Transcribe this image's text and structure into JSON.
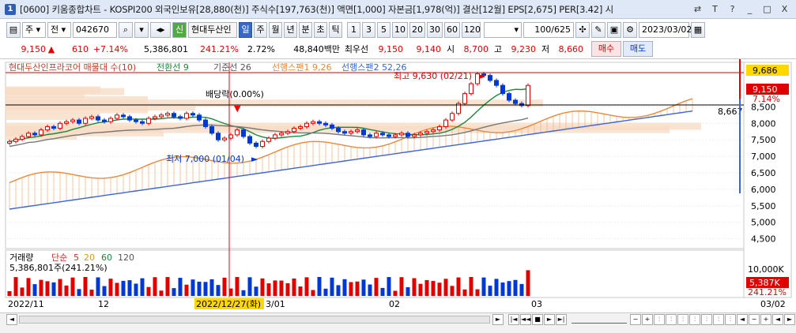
{
  "window": {
    "number": "1",
    "title": "[0600] 키움종합차트 - KOSPI200 외국인보유[28,880(천)] 주식수[197,763(천)] 액면[1,000] 자본금[1,978(억)] 결산[12월] EPS[2,675] PER[3.42] 시",
    "controls": [
      "⇄",
      "T",
      "?",
      "_",
      "□",
      "X"
    ]
  },
  "toolbar": {
    "type_select": "주",
    "type_jeon": "전",
    "code": "042670",
    "company": "현대두산인",
    "company_badge": "신",
    "periods": [
      "일",
      "주",
      "월",
      "년",
      "분",
      "초",
      "틱"
    ],
    "active_period": "일",
    "intervals": [
      "1",
      "3",
      "5",
      "10",
      "20",
      "30",
      "60",
      "120"
    ],
    "count": "100",
    "total": "/625",
    "date": "2023/03/02"
  },
  "quote": {
    "price": "9,150",
    "arrow": "▲",
    "change": "610",
    "change_pct": "+7.14%",
    "volume": "5,386,801",
    "volume_ratio": "241.21%",
    "turnover": "2.72%",
    "amount": "48,840백만",
    "priority_label": "최우선",
    "ask": "9,150",
    "bid": "9,140",
    "open_label": "시",
    "open": "8,700",
    "high_label": "고",
    "high": "9,230",
    "low_label": "저",
    "low": "8,660",
    "buy_label": "매수",
    "sell_label": "매도"
  },
  "chart": {
    "legend": {
      "name": "현대두산인프라코어 매물대 수(10)",
      "conv": "전환선 9",
      "base": "기준선 26",
      "span1": "선행스팬1 9,26",
      "span2": "선행스팬2 52,26"
    },
    "annotations": {
      "dividend": "배당락(0.00%)",
      "min": "최저 7,000 (01/04)",
      "max": "최고 9,630 (02/21)",
      "last_price_label": "8,667"
    },
    "price_axis": [
      "9,686",
      "9,150",
      "7.14%",
      "8,500",
      "8,000",
      "7,500",
      "7,000",
      "6,500",
      "6,000",
      "5,500",
      "5,000",
      "4,500"
    ],
    "volume_legend": {
      "title": "거래량",
      "ma_label": "단순",
      "ma5": "5",
      "ma20": "20",
      "ma60": "60",
      "ma120": "120",
      "current": "5,386,801주(241.21%)"
    },
    "volume_axis": [
      "10,000K",
      "5,000K",
      "5,387K",
      "241.21%"
    ],
    "x_labels": [
      "2022/11",
      "12",
      "2022/12/27(화)",
      "3/01",
      "02",
      "03",
      "03/02"
    ]
  },
  "chart_data": {
    "type": "candlestick",
    "title": "현대두산인프라코어",
    "ylim": [
      4300,
      9800
    ],
    "last_close": 9150,
    "high": 9630,
    "low": 7000,
    "closes": [
      7450,
      7520,
      7600,
      7700,
      7650,
      7800,
      7900,
      7850,
      8000,
      8050,
      8100,
      8000,
      8150,
      8200,
      8100,
      8050,
      8150,
      8250,
      8200,
      8100,
      8050,
      8000,
      8150,
      8200,
      8250,
      8300,
      8200,
      8150,
      8300,
      8250,
      8100,
      7900,
      7700,
      7500,
      7550,
      7650,
      7800,
      7600,
      7400,
      7300,
      7450,
      7550,
      7650,
      7700,
      7750,
      7850,
      7900,
      8000,
      8050,
      8000,
      7950,
      7850,
      7750,
      7700,
      7750,
      7800,
      7650,
      7600,
      7700,
      7650,
      7600,
      7650,
      7700,
      7600,
      7650,
      7700,
      7750,
      7800,
      7900,
      8100,
      8300,
      8600,
      8900,
      9200,
      9500,
      9450,
      9300,
      9150,
      8900,
      8700,
      8600,
      8540,
      9150
    ]
  }
}
